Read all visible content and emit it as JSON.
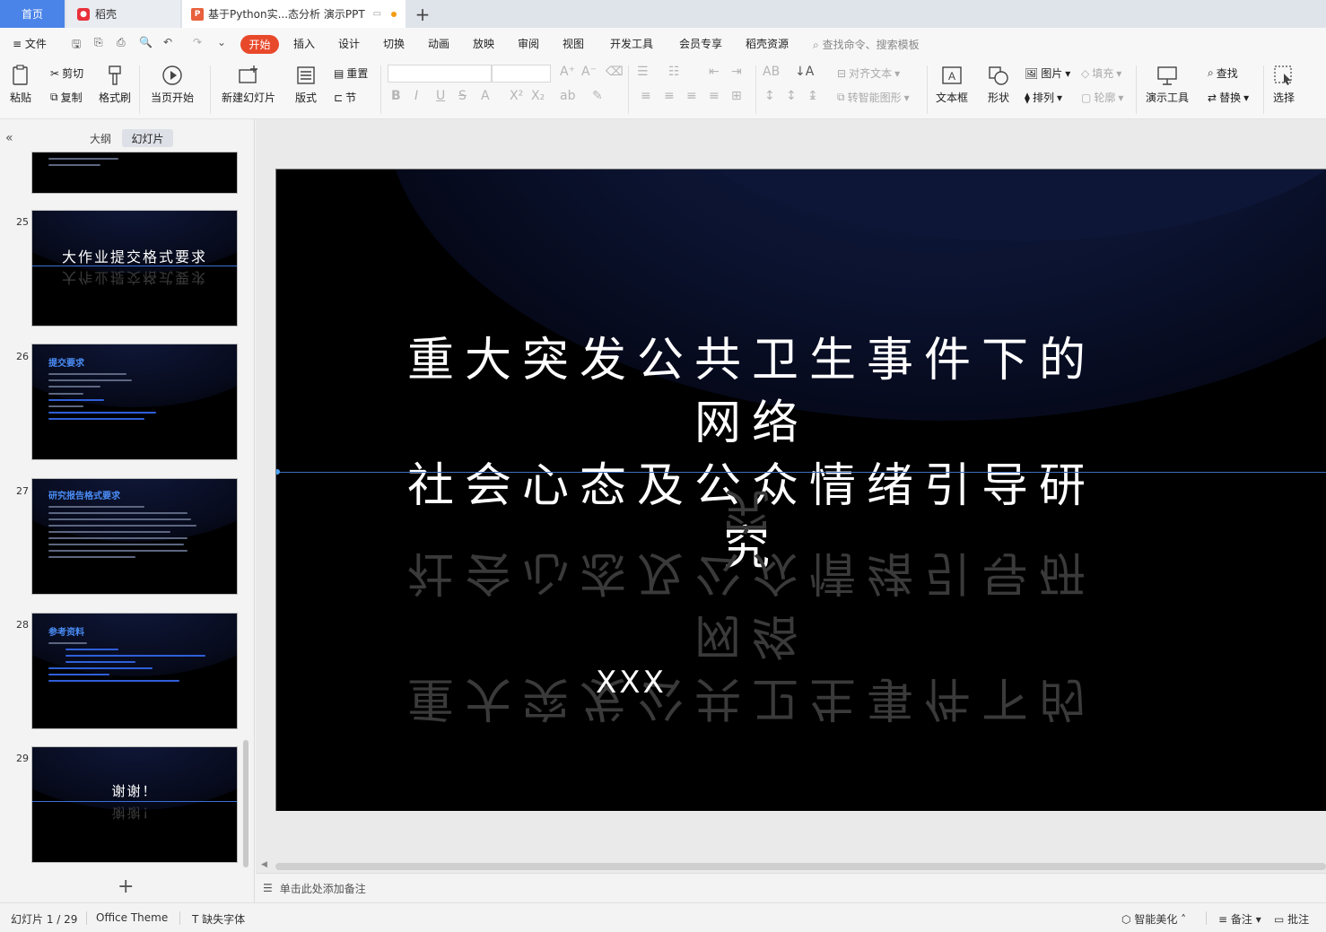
{
  "tabs": {
    "home": "首页",
    "daoke": "稻壳",
    "doc": "基于Python实...态分析 演示PPT",
    "add": "+"
  },
  "menu": {
    "file": "文件",
    "items": [
      "开始",
      "插入",
      "设计",
      "切换",
      "动画",
      "放映",
      "审阅",
      "视图",
      "开发工具",
      "会员专享",
      "稻壳资源"
    ],
    "search": "查找命令、搜索模板"
  },
  "ribbon": {
    "paste": "粘贴",
    "cut": "剪切",
    "copy": "复制",
    "format_painter": "格式刷",
    "from_current": "当页开始",
    "new_slide": "新建幻灯片",
    "layout": "版式",
    "reset": "重置",
    "section": "节",
    "align_text": "对齐文本",
    "to_smartart": "转智能图形",
    "textbox": "文本框",
    "shape": "形状",
    "picture": "图片",
    "arrange": "排列",
    "fill": "填充",
    "outline": "轮廓",
    "presenter_tools": "演示工具",
    "find": "查找",
    "replace": "替换",
    "select": "选择"
  },
  "left_panel": {
    "outline_tab": "大纲",
    "slides_tab": "幻灯片",
    "thumbs": [
      {
        "num": "25",
        "title": "大作业提交格式要求"
      },
      {
        "num": "26",
        "title": "提交要求"
      },
      {
        "num": "27",
        "title": "研究报告格式要求"
      },
      {
        "num": "28",
        "title": "参考资料"
      },
      {
        "num": "29",
        "title": "谢谢！"
      }
    ],
    "add": "+"
  },
  "slide": {
    "title_line1": "重大突发公共卫生事件下的网络",
    "title_line2": "社会心态及公众情绪引导研究",
    "author": "XXX"
  },
  "notes": {
    "placeholder": "单击此处添加备注"
  },
  "status": {
    "slide_counter": "幻灯片 1 / 29",
    "theme": "Office Theme",
    "missing_font": "缺失字体",
    "beautify": "智能美化",
    "notes": "备注",
    "comments": "批注"
  },
  "colors": {
    "accent_red": "#e8492b",
    "home_tab_blue": "#4b84e8",
    "slide_line": "#3d6fc5",
    "thumb_heading": "#4a8cf5"
  }
}
